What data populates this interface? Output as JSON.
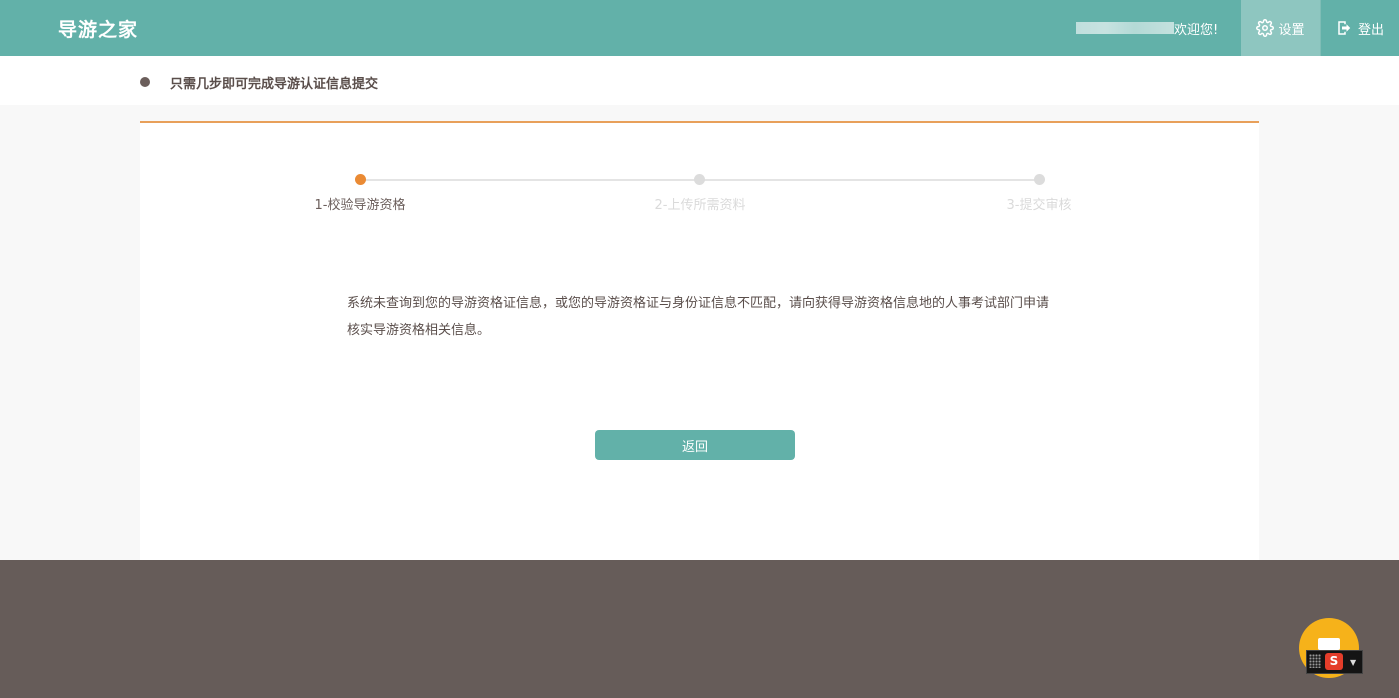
{
  "header": {
    "logo": "导游之家",
    "welcome": "欢迎您!",
    "settings_label": "设置",
    "logout_label": "登出"
  },
  "notice": {
    "text": "只需几步即可完成导游认证信息提交"
  },
  "steps": [
    {
      "label": "1-校验导游资格",
      "active": true
    },
    {
      "label": "2-上传所需资料",
      "active": false
    },
    {
      "label": "3-提交审核",
      "active": false
    }
  ],
  "message": {
    "line1": "系统未查询到您的导游资格证信息，或您的导游资格证与身份证信息不匹配，请向获得导游资格信息地的人事考试部门申请",
    "line2": "核实导游资格相关信息。"
  },
  "actions": {
    "back_label": "返回"
  },
  "ime": {
    "badge": "S"
  },
  "colors": {
    "primary": "#62b1a9",
    "accent": "#ea8a34",
    "footer": "#665c59"
  },
  "icons": {
    "settings": "gear-icon",
    "logout": "logout-icon"
  }
}
